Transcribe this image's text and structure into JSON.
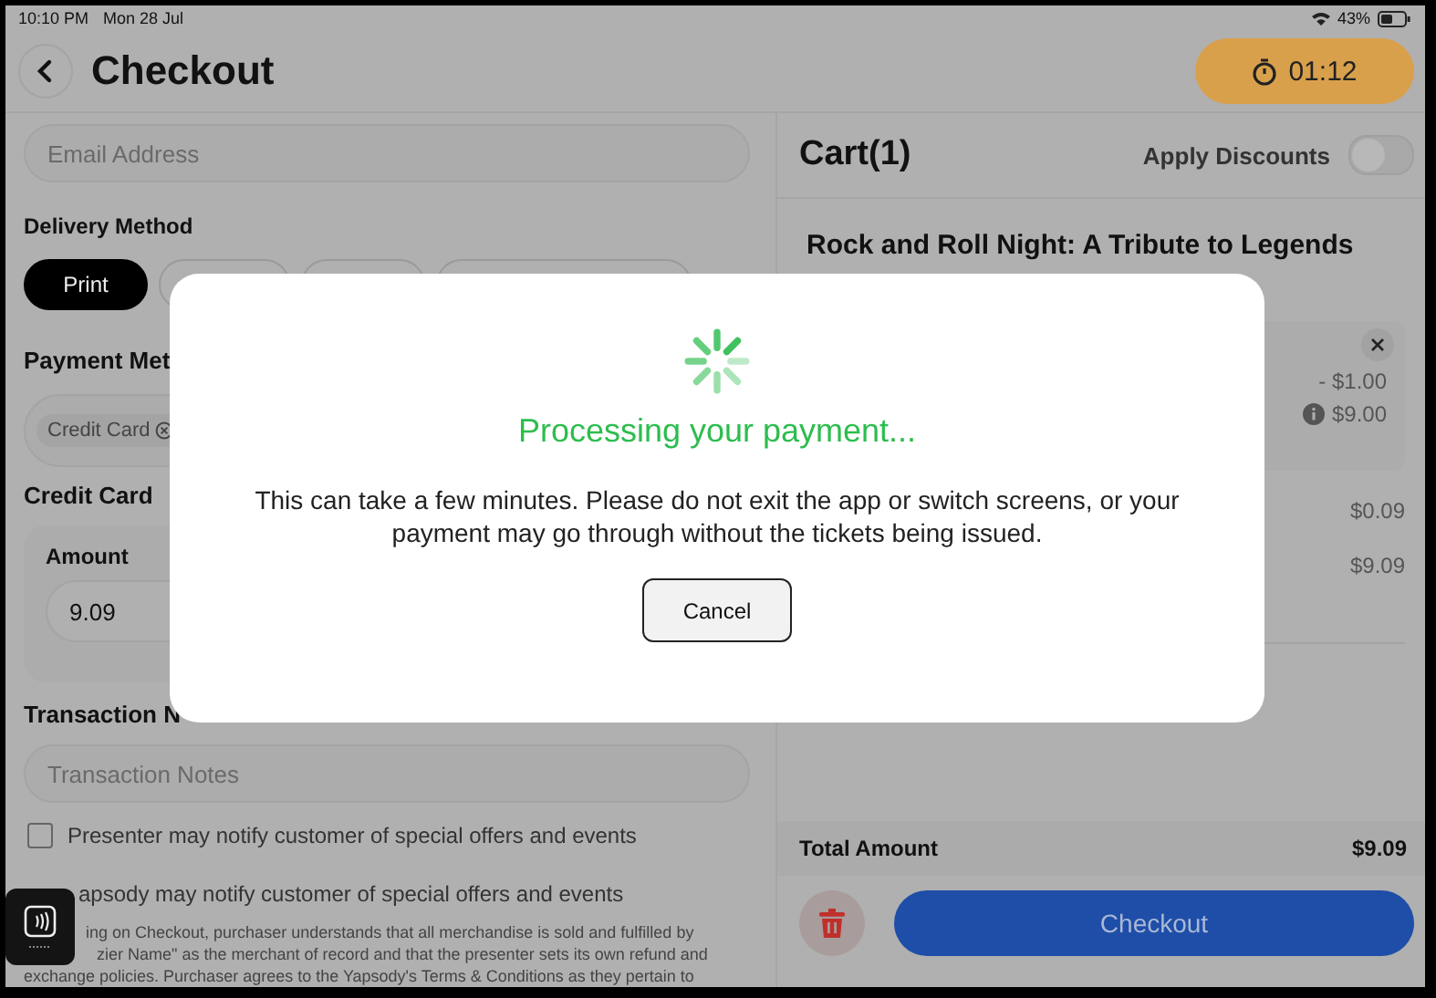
{
  "status_bar": {
    "time": "10:10 PM",
    "date": "Mon 28 Jul",
    "battery": "43%"
  },
  "header": {
    "title": "Checkout",
    "timer": "01:12"
  },
  "form": {
    "email": {
      "placeholder": "Email Address"
    },
    "delivery": {
      "label": "Delivery Method",
      "options": [
        {
          "label": "Print",
          "selected": true
        },
        {
          "selected": false
        },
        {
          "selected": false
        },
        {
          "selected": false
        }
      ]
    },
    "payment": {
      "label": "Payment Met",
      "chips": [
        {
          "label": "Credit Card"
        }
      ]
    },
    "credit_card": {
      "label": "Credit Card",
      "amount_label": "Amount",
      "amount": "9.09"
    },
    "notes": {
      "label": "Transaction N",
      "placeholder": "Transaction Notes"
    },
    "consents": [
      {
        "label": "Presenter may notify customer of special offers and events",
        "checked": false
      },
      {
        "label": "apsody may notify customer of special offers and events"
      }
    ],
    "fine_print": [
      "ing on Checkout, purchaser understands that all merchandise is sold and fulfilled by",
      "zier Name\" as the merchant of record and that the presenter sets its own refund and",
      "exchange policies. Purchaser agrees to the Yapsody's Terms & Conditions as they pertain to"
    ]
  },
  "cart": {
    "title": "Cart(1)",
    "apply_discounts": {
      "label": "Apply Discounts",
      "on": false
    },
    "event": "Rock and Roll Night: A Tribute to Legends",
    "ticket": {
      "discount": "- $1.00",
      "price": "$9.00"
    },
    "rows": [
      "$0.09",
      "$9.09"
    ],
    "total": {
      "label": "Total Amount",
      "value": "$9.09"
    },
    "checkout": "Checkout"
  },
  "dialog": {
    "title": "Processing your payment...",
    "message": "This can take a few minutes. Please do not exit the app or switch screens, or your payment may go through without the tickets being issued.",
    "cancel": "Cancel"
  }
}
